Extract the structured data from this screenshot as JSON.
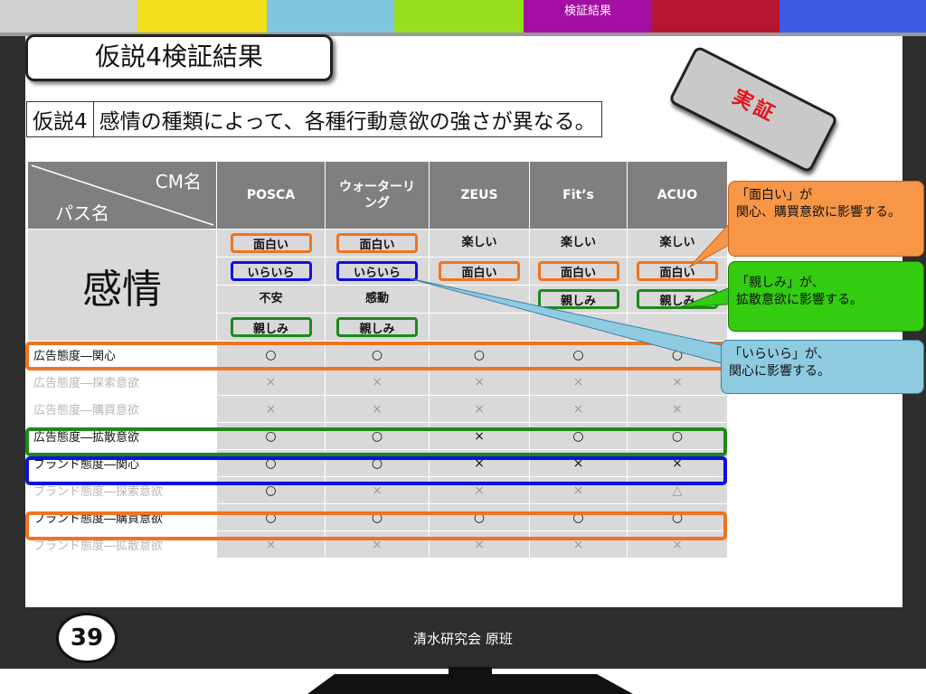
{
  "header_bar": {
    "section_title": "検証結果",
    "colors": [
      "#d0d0d0",
      "#f2df1a",
      "#7fc6e0",
      "#96e01e",
      "#a30fa3",
      "#b5152f",
      "#3c5ae6"
    ]
  },
  "slide": {
    "title": "仮説4検証結果",
    "hypothesis_label": "仮説4",
    "hypothesis_text": "感情の種類によって、各種行動意欲の強さが異なる。",
    "stamp": "実証",
    "page_number": "39",
    "footer": "清水研究会 原班"
  },
  "table": {
    "corner_top": "CM名",
    "corner_bottom": "パス名",
    "columns": [
      "POSCA",
      "ウォーターリング",
      "ZEUS",
      "Fit’s",
      "ACUO"
    ],
    "emotion_label": "感情",
    "emotion_rows": [
      [
        "面白い",
        "面白い",
        "楽しい",
        "楽しい",
        "楽しい"
      ],
      [
        "いらいら",
        "いらいら",
        "面白い",
        "面白い",
        "面白い"
      ],
      [
        "不安",
        "感動",
        "",
        "親しみ",
        "親しみ"
      ],
      [
        "親しみ",
        "親しみ",
        "",
        "",
        ""
      ]
    ],
    "rows": [
      {
        "label": "広告態度―関心",
        "values": [
          "○",
          "○",
          "○",
          "○",
          "○"
        ],
        "dim": false
      },
      {
        "label": "広告態度―探索意欲",
        "values": [
          "×",
          "×",
          "×",
          "×",
          "×"
        ],
        "dim": true
      },
      {
        "label": "広告態度―購買意欲",
        "values": [
          "×",
          "×",
          "×",
          "×",
          "×"
        ],
        "dim": true
      },
      {
        "label": "広告態度―拡散意欲",
        "values": [
          "○",
          "○",
          "×",
          "○",
          "○"
        ],
        "dim": false
      },
      {
        "label": "ブランド態度―関心",
        "values": [
          "○",
          "○",
          "×",
          "×",
          "×"
        ],
        "dim": false
      },
      {
        "label": "ブランド態度―探索意欲",
        "values": [
          "○",
          "×",
          "×",
          "×",
          "△"
        ],
        "dim": true
      },
      {
        "label": "ブランド態度―購買意欲",
        "values": [
          "○",
          "○",
          "○",
          "○",
          "○"
        ],
        "dim": false
      },
      {
        "label": "ブランド態度―拡散意欲",
        "values": [
          "×",
          "×",
          "×",
          "×",
          "×"
        ],
        "dim": true
      }
    ]
  },
  "callouts": {
    "orange": "「面白い」が\n関心、購買意欲に影響する。",
    "green": "「親しみ」が、\n拡散意欲に影響する。",
    "blue": "「いらいら」が、\n関心に影響する。"
  }
}
